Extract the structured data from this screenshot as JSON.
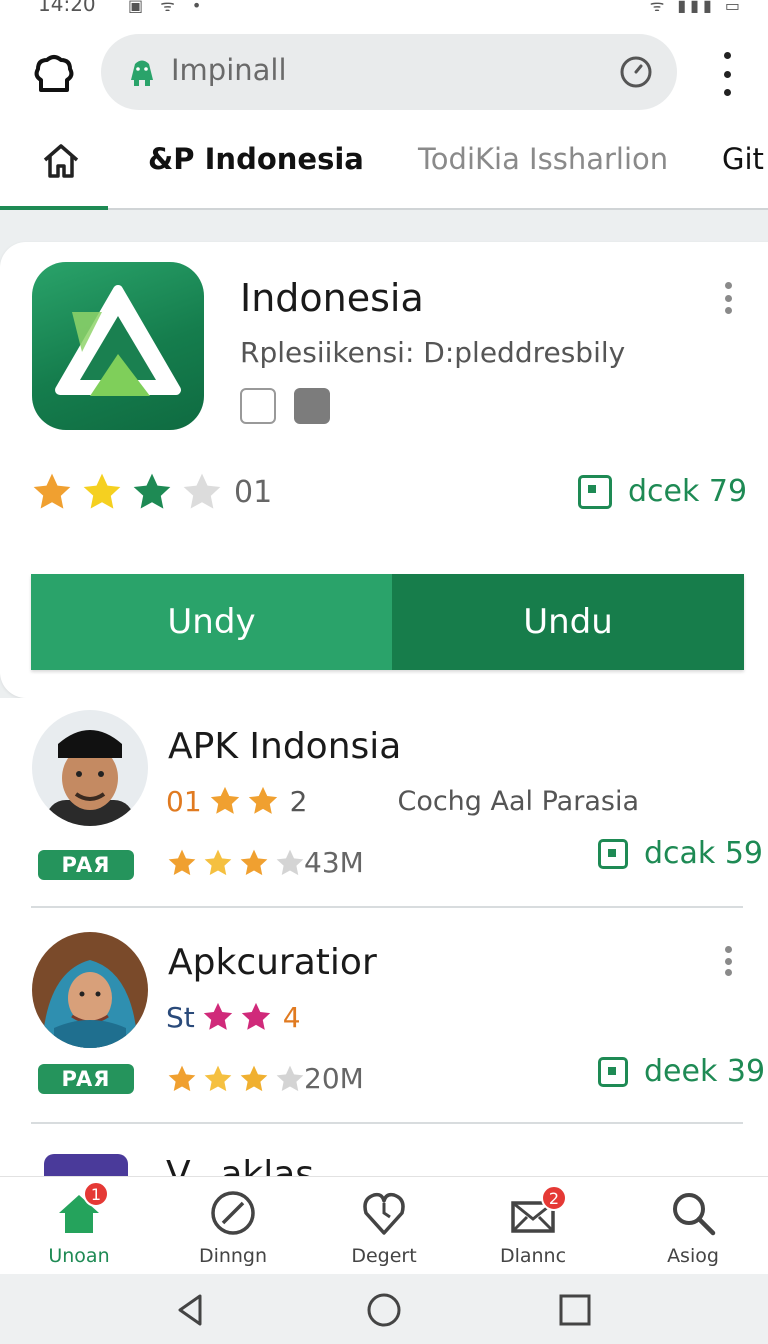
{
  "status_bar": {
    "time": "14:20",
    "icons_left": "▣ ᯤ •",
    "icons_right": "ᯤ ▮▮▮ ▭"
  },
  "top_bar": {
    "search_text": "Impinall"
  },
  "tabs": {
    "active": "&P Indonesia",
    "second": "TodiKia Issharlion",
    "third": "Git"
  },
  "featured": {
    "title": "Indonesia",
    "subtitle": "Rplesiikensi: D:pleddresbily",
    "rating_count": "01",
    "download_chip": "dcek 79",
    "button_left": "Undy",
    "button_right": "Undu"
  },
  "list": [
    {
      "title": "APK Indonsia",
      "meta_num": "01",
      "meta_extra": "2",
      "developer": "Cochg Aal Parasia",
      "tag": "PAЯ",
      "size": "43M",
      "download_chip": "dcak 59"
    },
    {
      "title": "Apkcuratior",
      "meta_num": "St",
      "meta_extra": "4",
      "developer": "",
      "tag": "PAЯ",
      "size": "20M",
      "download_chip": "deek 39"
    }
  ],
  "partial_item_title": "V...aklas",
  "bottom_nav": [
    {
      "label": "Unoan",
      "badge": "1",
      "icon": "home-icon"
    },
    {
      "label": "Dinngn",
      "badge": "",
      "icon": "compass-icon"
    },
    {
      "label": "Degert",
      "badge": "",
      "icon": "heart-clock-icon"
    },
    {
      "label": "Dlannc",
      "badge": "2",
      "icon": "mail-icon"
    },
    {
      "label": "Asiog",
      "badge": "",
      "icon": "search-icon"
    }
  ],
  "colors": {
    "accent": "#1e8a54",
    "accent_light": "#2aa36a",
    "badge": "#e53935"
  }
}
